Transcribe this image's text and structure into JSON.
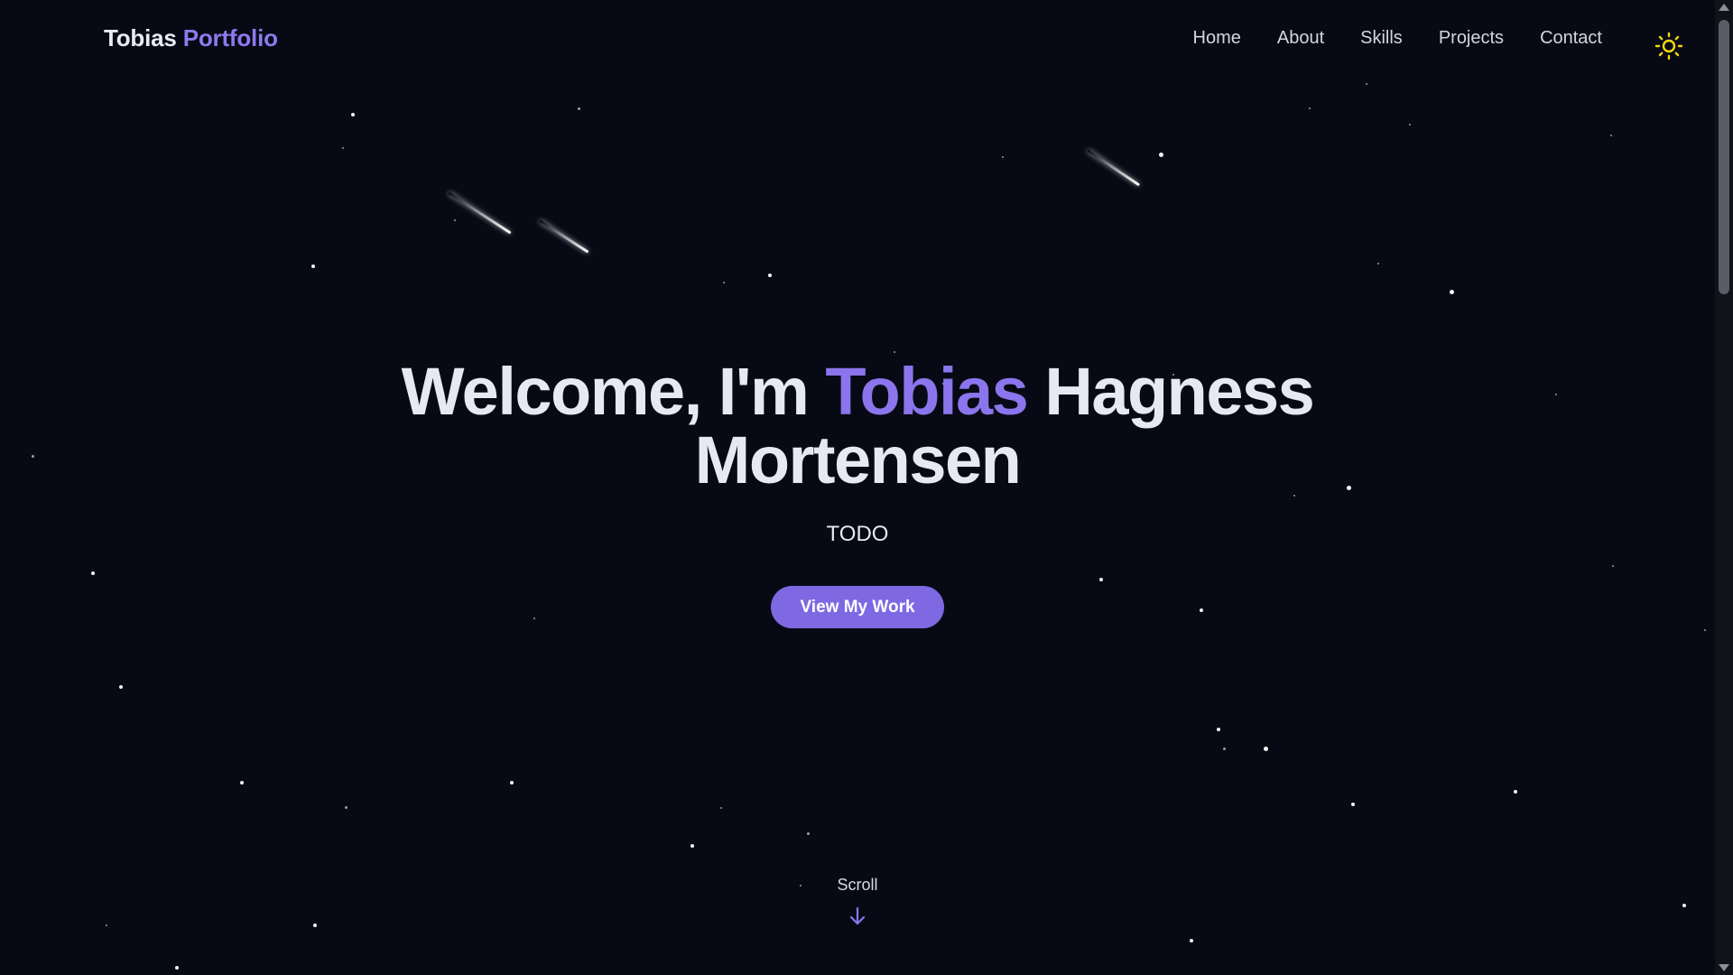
{
  "nav": {
    "logo_primary": "Tobias",
    "logo_accent": "Portfolio",
    "items": [
      {
        "label": "Home"
      },
      {
        "label": "About"
      },
      {
        "label": "Skills"
      },
      {
        "label": "Projects"
      },
      {
        "label": "Contact"
      }
    ],
    "theme_toggle_icon": "sun-icon"
  },
  "hero": {
    "title_prefix": "Welcome, I'm",
    "title_accent": "Tobias",
    "title_rest": "Hagness",
    "title_line2": "Mortensen",
    "subtitle": "TODO",
    "cta_label": "View My Work"
  },
  "scroll": {
    "label": "Scroll",
    "icon": "arrow-down-icon"
  },
  "colors": {
    "background": "#070a14",
    "accent": "#8b75ec",
    "button": "#7e69e3",
    "sun": "#f5d90a"
  }
}
